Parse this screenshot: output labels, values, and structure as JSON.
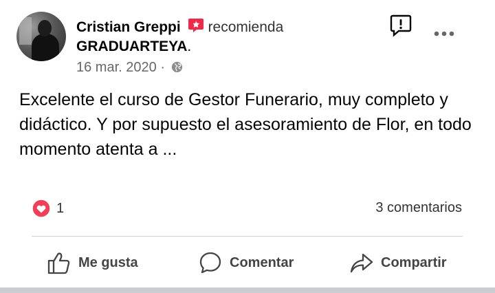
{
  "post": {
    "author": "Cristian Greppi",
    "action_text": "recomienda",
    "page_name": "GRADUARTEYA",
    "page_suffix": ".",
    "date": "16 mar. 2020",
    "date_separator": "·",
    "body": "Excelente el curso de Gestor Funerario, muy completo y didáctico. Y por supuesto el asesoramiento de Flor, en todo momento atenta a ..."
  },
  "stats": {
    "reaction_count": "1",
    "comments_label": "3 comentarios"
  },
  "actions": {
    "like": "Me gusta",
    "comment": "Comentar",
    "share": "Compartir"
  },
  "colors": {
    "recommend_badge": "#f0284a",
    "heart_reaction": "#f33e58",
    "secondary_text": "#65676b",
    "divider": "#ced0d4"
  },
  "icons": {
    "recommend": "recommend-badge-icon",
    "privacy": "globe-icon",
    "report": "report-flag-icon",
    "more": "more-options-icon",
    "reaction": "heart-reaction-icon",
    "like": "thumbs-up-icon",
    "comment": "comment-bubble-icon",
    "share": "share-arrow-icon"
  }
}
